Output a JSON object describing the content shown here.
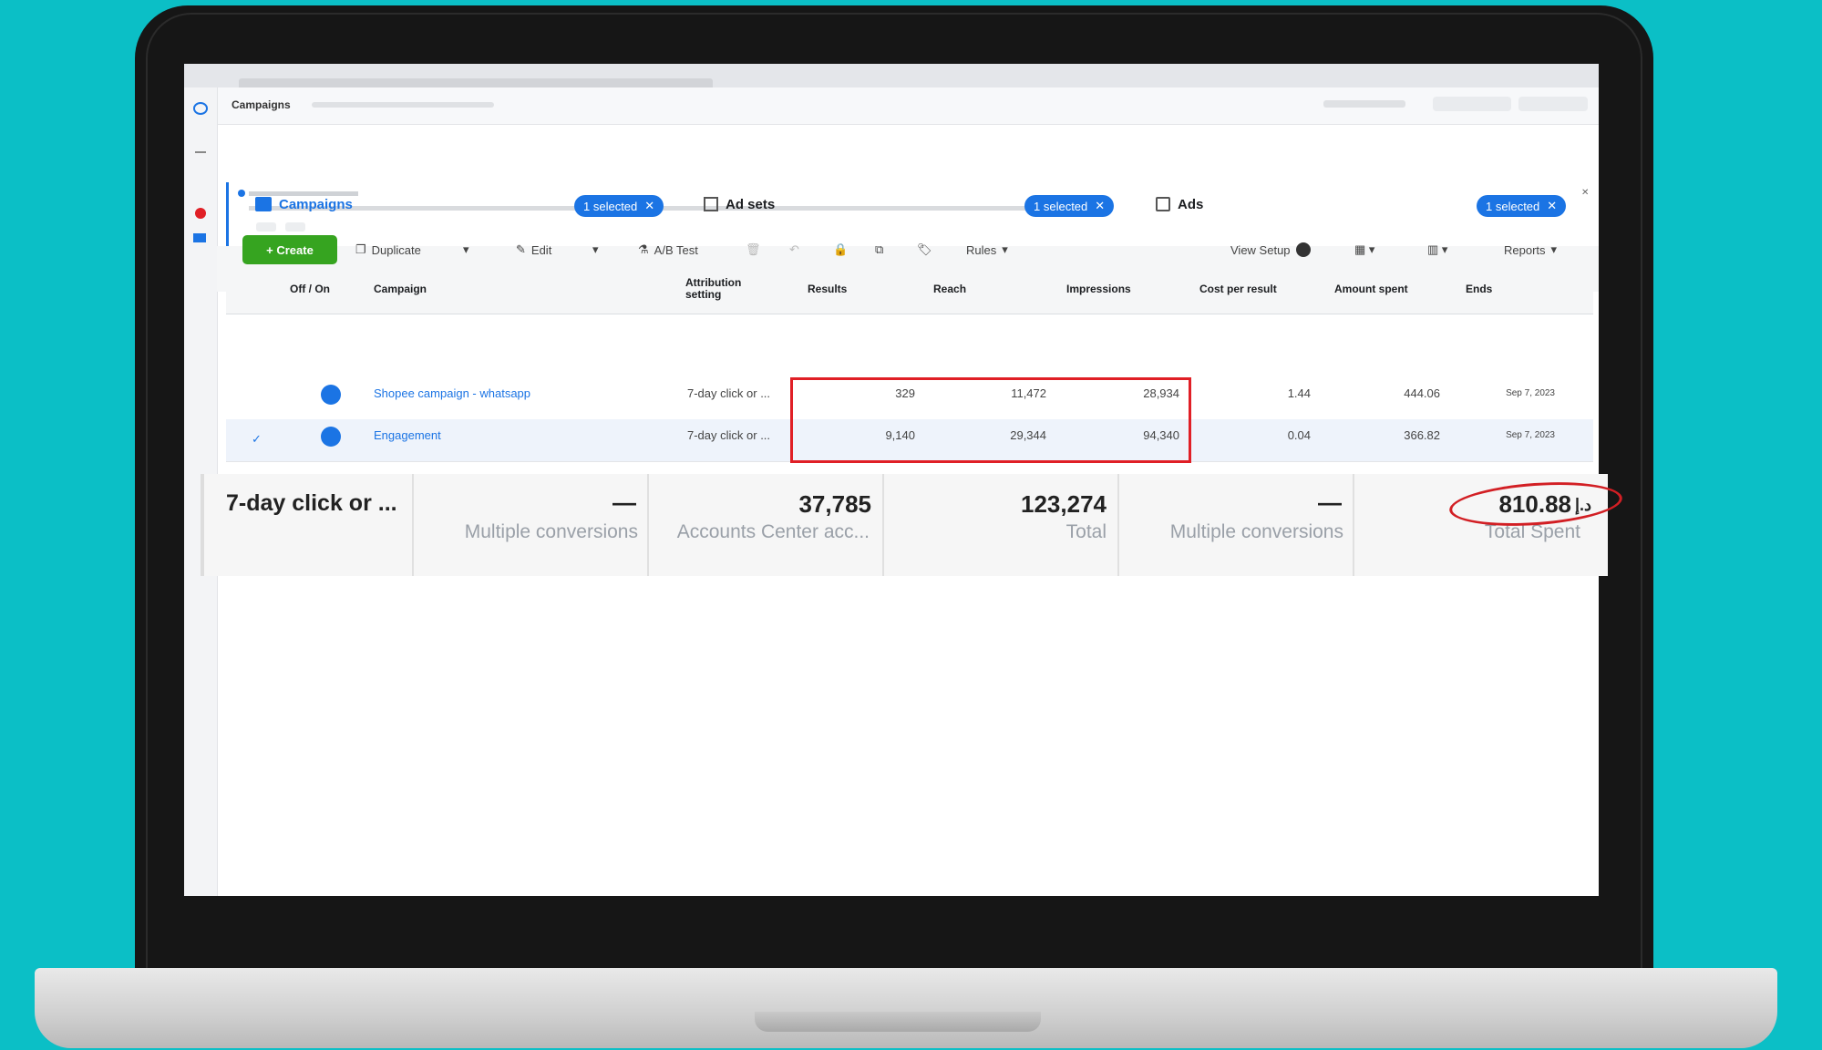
{
  "header": {
    "section": "Campaigns"
  },
  "tabs": [
    {
      "label": "Campaigns",
      "selected_label": "1 selected"
    },
    {
      "label": "Ad sets",
      "selected_label": "1 selected"
    },
    {
      "label": "Ads",
      "selected_label": "1 selected"
    }
  ],
  "toolbar": {
    "create": "+ Create",
    "duplicate": "Duplicate",
    "edit": "Edit",
    "ab_test": "A/B Test",
    "rules": "Rules",
    "view_setup": "View Setup",
    "reports": "Reports"
  },
  "columns": [
    "Off / On",
    "Campaign",
    "Attribution setting",
    "Results",
    "Reach",
    "Impressions",
    "Cost per result",
    "Amount spent",
    "Ends"
  ],
  "rows": [
    {
      "campaign": "Shopee campaign - whatsapp",
      "attribution": "7-day click or ...",
      "results": "329",
      "reach": "11,472",
      "impressions": "28,934",
      "cost": "1.44",
      "spent": "444.06",
      "ends": "Sep 7, 2023"
    },
    {
      "campaign": "Engagement",
      "attribution": "7-day click or ...",
      "results": "9,140",
      "reach": "29,344",
      "impressions": "94,340",
      "cost": "0.04",
      "spent": "366.82",
      "ends": "Sep 7, 2023"
    }
  ],
  "summary": {
    "attribution": "7-day click or ...",
    "results_value": "—",
    "results_label": "Multiple conversions",
    "reach_value": "37,785",
    "reach_label": "Accounts Center acc...",
    "impressions_value": "123,274",
    "impressions_label": "Total",
    "cost_value": "—",
    "cost_label": "Multiple conversions",
    "spent_value": "810.88",
    "spent_currency": "د.إ",
    "spent_label": "Total Spent"
  },
  "colors": {
    "accent": "#1b74e4",
    "create": "#36a420",
    "highlight": "#e01f26",
    "background": "#0bbfc6"
  }
}
